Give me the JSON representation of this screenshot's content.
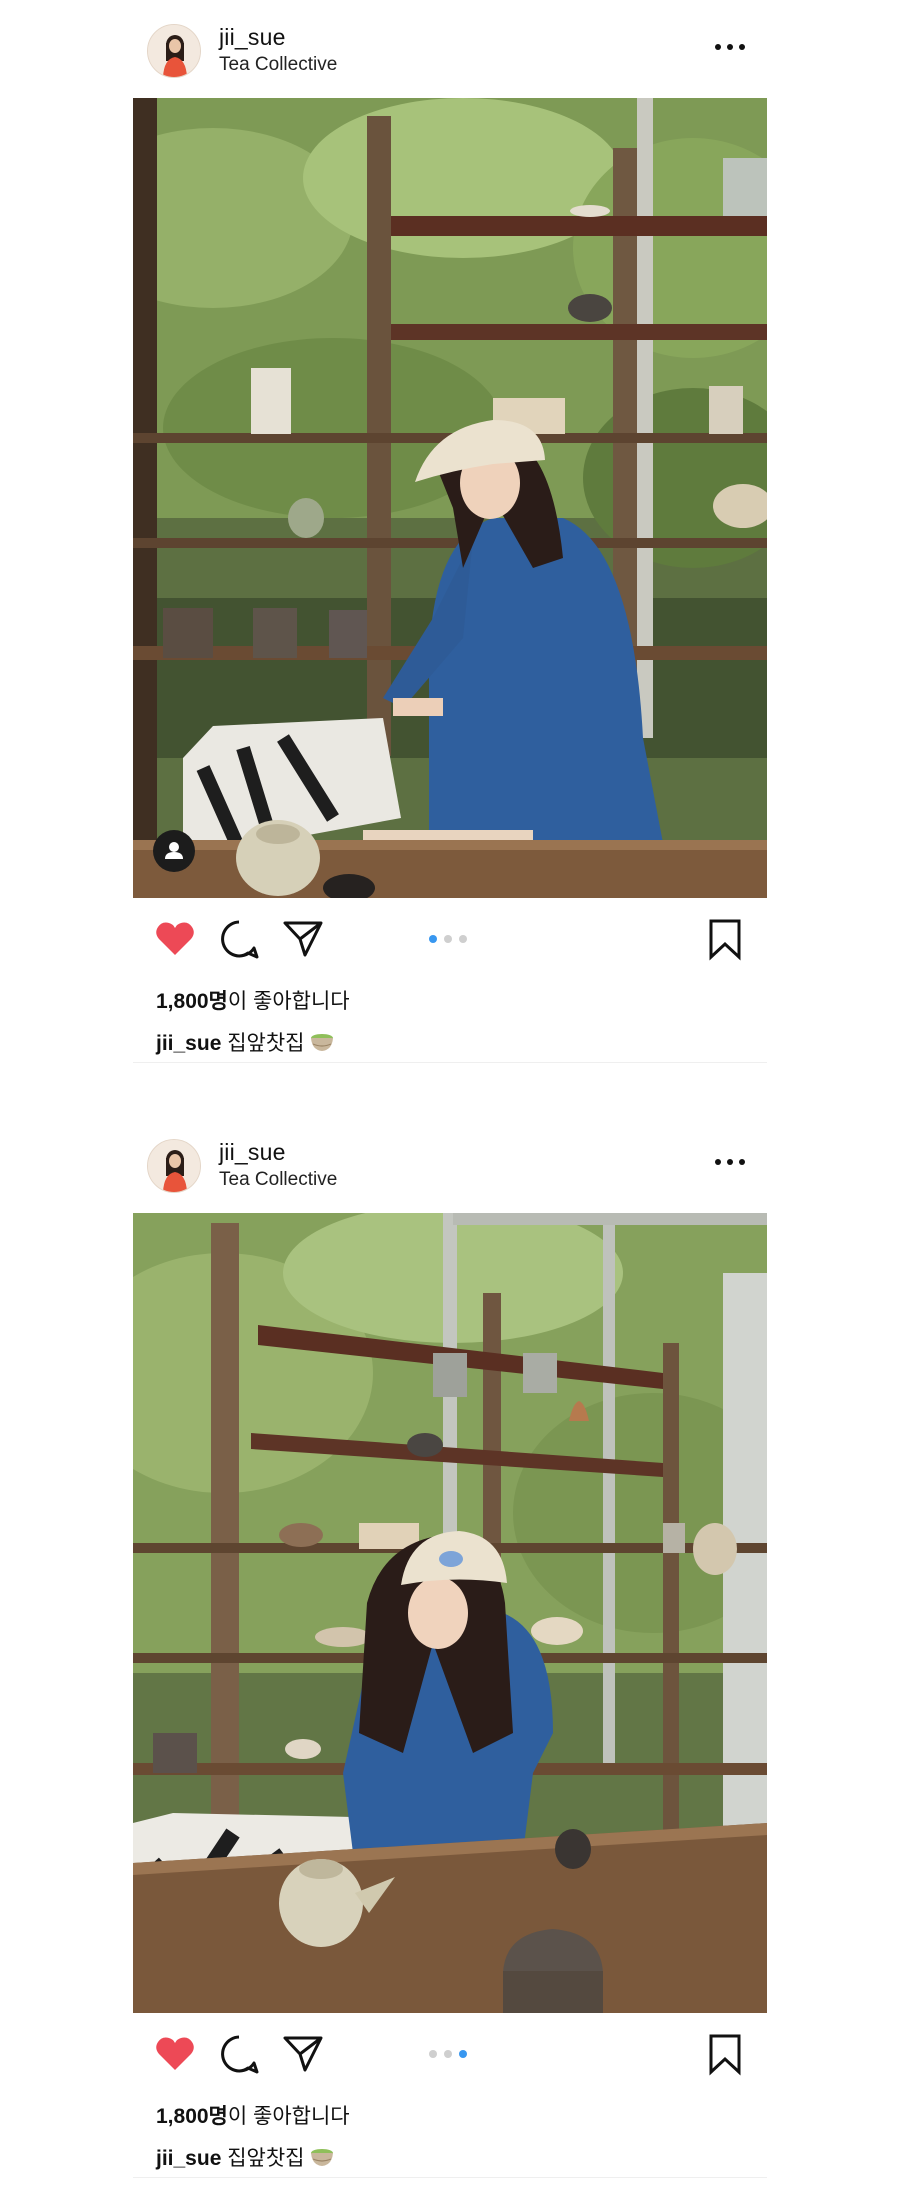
{
  "posts": [
    {
      "username": "jii_sue",
      "location": "Tea Collective",
      "likes_count": "1,800명",
      "likes_suffix": "이 좋아합니다",
      "caption_user": "jii_sue",
      "caption_text": "집앞찻집",
      "caption_emoji": "matcha-tea-icon",
      "carousel": {
        "total": 3,
        "active": 1
      },
      "liked": true
    },
    {
      "username": "jii_sue",
      "location": "Tea Collective",
      "likes_count": "1,800명",
      "likes_suffix": "이 좋아합니다",
      "caption_user": "jii_sue",
      "caption_text": "집앞찻집",
      "caption_emoji": "matcha-tea-icon",
      "carousel": {
        "total": 3,
        "active": 3
      },
      "liked": true
    }
  ],
  "colors": {
    "heart": "#ed4956",
    "active_dot": "#3897f0",
    "inactive_dot": "#cfcfcf"
  }
}
